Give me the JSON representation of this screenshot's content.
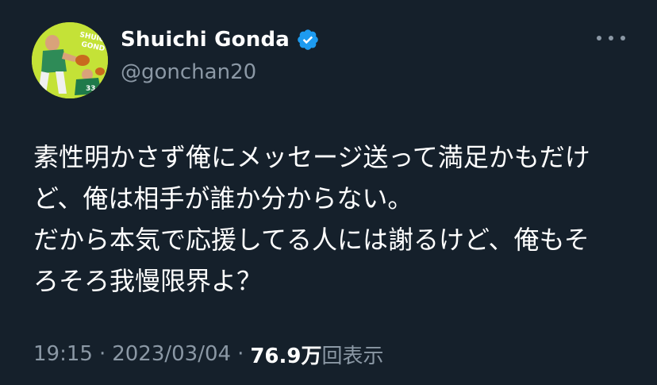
{
  "user": {
    "display_name": "Shuichi Gonda",
    "handle": "@gonchan20",
    "verified": true,
    "avatar_text": "SHUICHI GONDA"
  },
  "tweet": {
    "lines": [
      "素性明かさず俺にメッセージ送って満足かもだけ",
      "ど、俺は相手が誰か分からない。",
      "だから本気で応援してる人には謝るけど、俺もそ",
      "ろそろ我慢限界よ？"
    ],
    "time": "19:15",
    "separator": "·",
    "date": "2023/03/04",
    "views_count": "76.9万",
    "views_label": "回表示"
  },
  "colors": {
    "background": "#15202b",
    "primary_text": "#ffffff",
    "secondary_text": "#8b98a5",
    "verified_blue": "#1d9bf0",
    "avatar_bg": "#c4e237"
  },
  "icons": {
    "verified": "verified-badge-icon",
    "more": "more-options-icon"
  }
}
